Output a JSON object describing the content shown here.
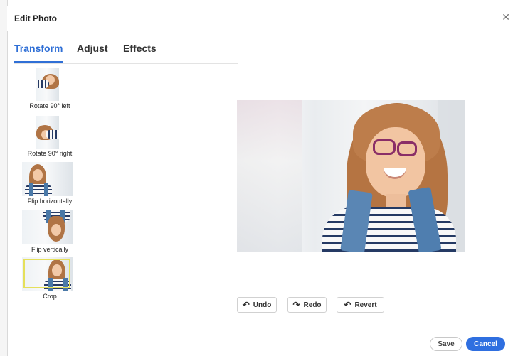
{
  "dialog": {
    "title": "Edit Photo",
    "close_icon": "✕"
  },
  "tabs": [
    {
      "label": "Transform"
    },
    {
      "label": "Adjust"
    },
    {
      "label": "Effects"
    }
  ],
  "tools": [
    {
      "label": "Rotate 90° left",
      "icon": "rotate-left-thumbnail"
    },
    {
      "label": "Rotate 90° right",
      "icon": "rotate-right-thumbnail"
    },
    {
      "label": "Flip horizontally",
      "icon": "flip-horizontal-thumbnail"
    },
    {
      "label": "Flip vertically",
      "icon": "flip-vertical-thumbnail"
    },
    {
      "label": "Crop",
      "icon": "crop-thumbnail"
    }
  ],
  "actions": {
    "undo": "Undo",
    "redo": "Redo",
    "revert": "Revert"
  },
  "footer": {
    "save": "Save",
    "cancel": "Cancel"
  },
  "colors": {
    "accent": "#2f6fe0",
    "tab_active": "#2f6fd6",
    "crop_frame": "#e5e05b"
  }
}
